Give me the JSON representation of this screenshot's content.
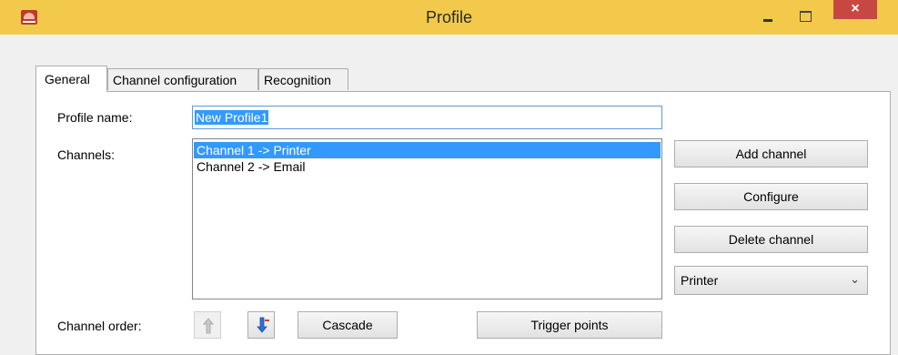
{
  "window": {
    "title": "Profile",
    "icon": "app-printer-icon",
    "controls": {
      "minimize": "minimize-icon",
      "maximize": "maximize-icon",
      "close_label": "×"
    }
  },
  "tabs": [
    {
      "label": "General",
      "active": true
    },
    {
      "label": "Channel configuration",
      "active": false
    },
    {
      "label": "Recognition",
      "active": false
    }
  ],
  "general": {
    "profile_name_label": "Profile name:",
    "profile_name_value": "New Profile1",
    "channels_label": "Channels:",
    "channels": [
      {
        "label": "Channel 1 -> Printer",
        "selected": true
      },
      {
        "label": "Channel 2 -> Email",
        "selected": false
      }
    ],
    "channel_order_label": "Channel order:",
    "buttons": {
      "add_channel": "Add channel",
      "configure": "Configure",
      "delete_channel": "Delete channel",
      "cascade": "Cascade",
      "trigger_points": "Trigger points"
    },
    "channel_type_select": {
      "value": "Printer",
      "arrow": "chevron-down-icon"
    },
    "order_icons": {
      "up": "move-up-icon",
      "down": "move-down-icon"
    }
  },
  "colors": {
    "titlebar": "#f2c94a",
    "close_button": "#c74843",
    "selection": "#3399ff",
    "focus_border": "#5b9bd5"
  }
}
